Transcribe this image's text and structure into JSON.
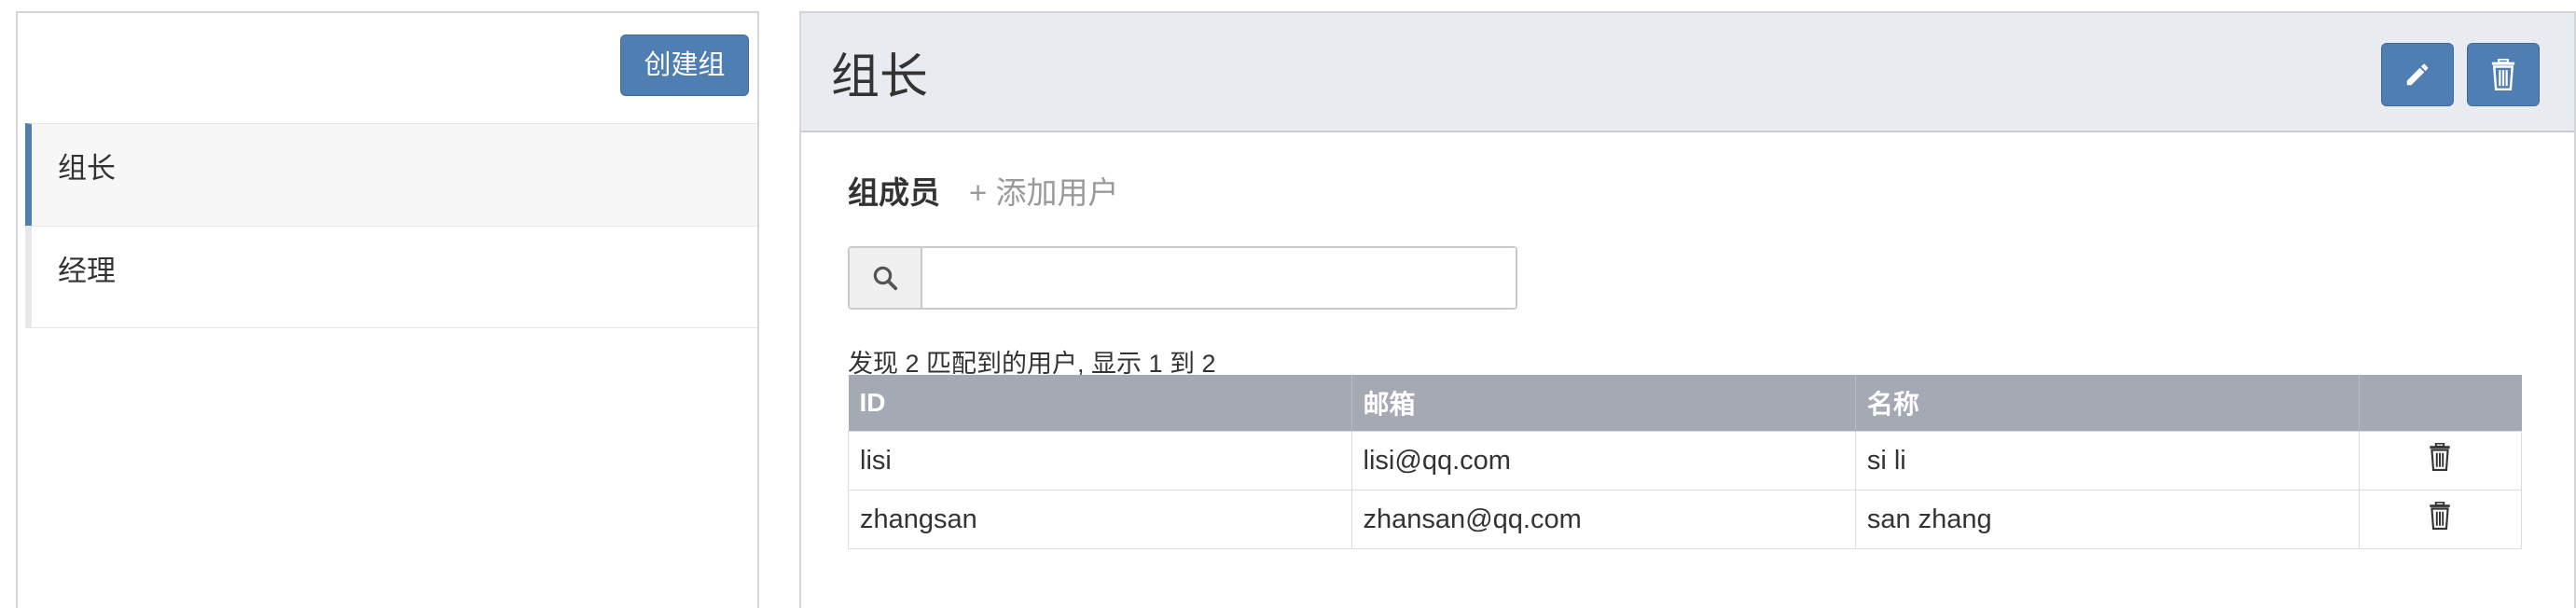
{
  "left_panel": {
    "create_button_label": "创建组",
    "groups": [
      {
        "label": "组长",
        "active": true
      },
      {
        "label": "经理",
        "active": false
      }
    ]
  },
  "right_panel": {
    "title": "组长",
    "members_title": "组成员",
    "add_user_label": "+ 添加用户",
    "search": {
      "value": "",
      "placeholder": ""
    },
    "result_text": "发现 2 匹配到的用户, 显示 1 到 2",
    "table": {
      "headers": [
        "ID",
        "邮箱",
        "名称",
        ""
      ],
      "rows": [
        {
          "id": "lisi",
          "email": "lisi@qq.com",
          "name": "si li"
        },
        {
          "id": "zhangsan",
          "email": "zhansan@qq.com",
          "name": "san zhang"
        }
      ]
    }
  },
  "colors": {
    "primary": "#4f7eb2",
    "header_bg": "#e8ebef",
    "table_header_bg": "#a4a9b3"
  },
  "icons": [
    "search-icon",
    "pencil-icon",
    "trash-icon"
  ]
}
